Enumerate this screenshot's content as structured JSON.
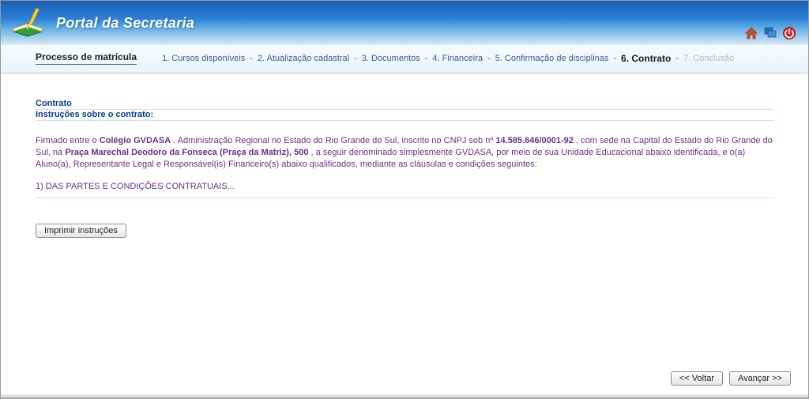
{
  "header": {
    "title": "Portal da Secretaria",
    "icons": {
      "home": "home-icon",
      "windows": "windows-icon",
      "power": "power-icon"
    }
  },
  "wizard": {
    "title": "Processo de matrícula",
    "steps": [
      {
        "label": "1. Cursos disponíveis",
        "state": "link"
      },
      {
        "label": "2. Atualização cadastral",
        "state": "link"
      },
      {
        "label": "3. Documentos",
        "state": "link"
      },
      {
        "label": "4. Financeira",
        "state": "link"
      },
      {
        "label": "5. Confirmação de disciplinas",
        "state": "link"
      },
      {
        "label": "6. Contrato",
        "state": "current"
      },
      {
        "label": "7. Conclusão",
        "state": "disabled"
      }
    ],
    "separator": " - "
  },
  "section": {
    "title": "Contrato",
    "subtitle": "Instruções sobre o contrato:"
  },
  "contract": {
    "intro_prefix": "Firmado entre o ",
    "institution": "Colégio GVDASA",
    "intro_mid1": " . Administração Regional no Estado do Rio Grande do Sul, inscrito no CNPJ sob nº ",
    "cnpj": "14.585.646/0001-92",
    "intro_mid2": " , com sede na Capital do Estado do Rio Grande do Sul, na ",
    "address": "Praça Marechal Deodoro da Fonseca (Praça da Matriz), 500",
    "intro_mid3": " , a seguir denominado simplesmente GVDASA, por meio de sua Unidade Educacional abaixo identificada, e o(a) Aluno(a), Representante Legal e Responsável(is) Financeiro(s) abaixo qualificados, mediante as cláusulas e condições seguintes:",
    "clause_1": "1) DAS PARTES E CONDIÇÕES CONTRATUAIS..."
  },
  "buttons": {
    "print": "Imprimir instruções",
    "back": "<< Voltar",
    "next": "Avançar >>"
  }
}
